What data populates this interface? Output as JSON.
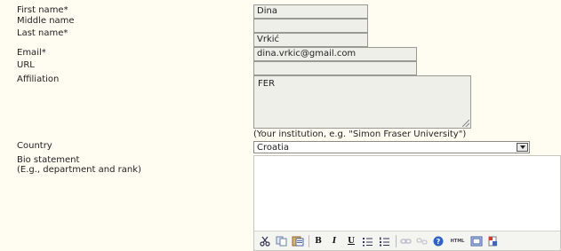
{
  "labels": {
    "first_name": "First name*",
    "middle_name": "Middle name",
    "last_name": "Last name*",
    "email": "Email*",
    "url": "URL",
    "affiliation": "Affiliation",
    "country": "Country",
    "bio_line1": "Bio statement",
    "bio_line2": "(E.g., department and rank)"
  },
  "values": {
    "first_name": "Dina",
    "middle_name": "",
    "last_name": "Vrkić",
    "email": "dina.vrkic@gmail.com",
    "url": "",
    "affiliation": "FER",
    "country": "Croatia"
  },
  "hints": {
    "affiliation": "(Your institution, e.g. \"Simon Fraser University\")"
  },
  "toolbar": {
    "bold": "B",
    "italic": "I",
    "underline": "U",
    "html": "HTML",
    "icons": [
      "cut-icon",
      "copy-icon",
      "paste-word-icon",
      "bold-icon",
      "italic-icon",
      "underline-icon",
      "bullet-list-icon",
      "numbered-list-icon",
      "link-icon",
      "unlink-icon",
      "help-icon",
      "html-icon",
      "fullscreen-icon",
      "paste-icon"
    ]
  },
  "colors": {
    "page_background": "#fffdf2",
    "field_background": "#efefe9"
  }
}
